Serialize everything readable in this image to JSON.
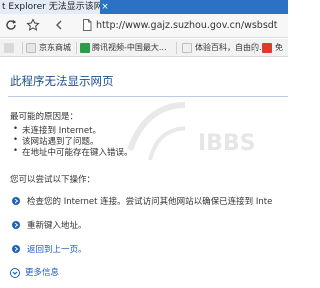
{
  "window": {
    "tab_title": "t Explorer 无法显示该网页",
    "tab_close": "×"
  },
  "address": {
    "url": "http://www.gajz.suzhou.gov.cn/wsbsdt"
  },
  "bookmarks": [
    {
      "label": "京东商城",
      "color": "#d9d9d9"
    },
    {
      "label": "腾讯视频-中国最大...",
      "color": "#2a9d4b"
    },
    {
      "label": "体验百科，自由的...",
      "color": "#cfcfcf"
    },
    {
      "label": "免",
      "color": "#e03a2a"
    }
  ],
  "content": {
    "title": "此程序无法显示网页",
    "reasons_heading": "最可能的原因是：",
    "reasons": [
      "未连接到 Internet。",
      "该网站遇到了问题。",
      "在地址中可能存在键入错误。"
    ],
    "try_heading": "您可以尝试以下操作：",
    "steps": [
      {
        "text": "检查您的 Internet 连接。尝试访问其他网站以确保已连接到 Inte",
        "link": false
      },
      {
        "text": "重新键入地址。",
        "link": false
      },
      {
        "text": "返回到上一页。",
        "link": true
      }
    ],
    "more_info": "更多信息"
  },
  "watermark": {
    "text": "IBBS"
  },
  "colors": {
    "titlebar": "#2b72c6",
    "link": "#1a5cc7",
    "title_text": "#1c4e8a",
    "step_icon": "#1f5fb4"
  }
}
